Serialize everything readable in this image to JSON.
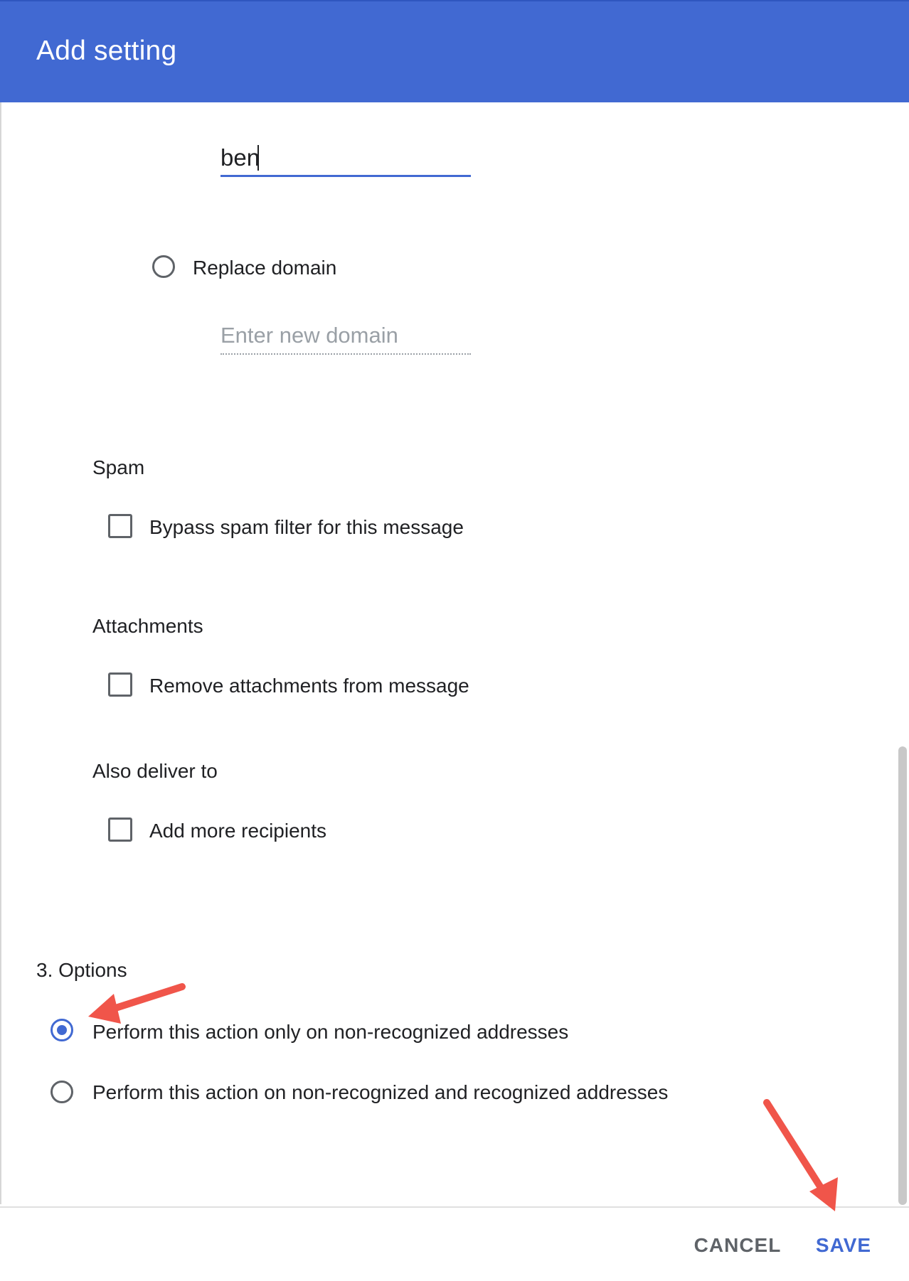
{
  "dialog": {
    "title": "Add setting"
  },
  "address_field": {
    "value": "ben"
  },
  "replace_domain": {
    "label": "Replace domain",
    "placeholder": "Enter new domain"
  },
  "spam": {
    "title": "Spam",
    "checkbox_label": "Bypass spam filter for this message"
  },
  "attachments": {
    "title": "Attachments",
    "checkbox_label": "Remove attachments from message"
  },
  "also_deliver": {
    "title": "Also deliver to",
    "checkbox_label": "Add more recipients"
  },
  "options": {
    "title": "3. Options",
    "items": [
      {
        "label": "Perform this action only on non-recognized addresses",
        "selected": true
      },
      {
        "label": "Perform this action on non-recognized and recognized addresses",
        "selected": false
      }
    ]
  },
  "footer": {
    "cancel_label": "CANCEL",
    "save_label": "SAVE"
  },
  "colors": {
    "header": "#4169d2",
    "accent": "#4169d2",
    "annotation_arrow": "#f0554a"
  }
}
